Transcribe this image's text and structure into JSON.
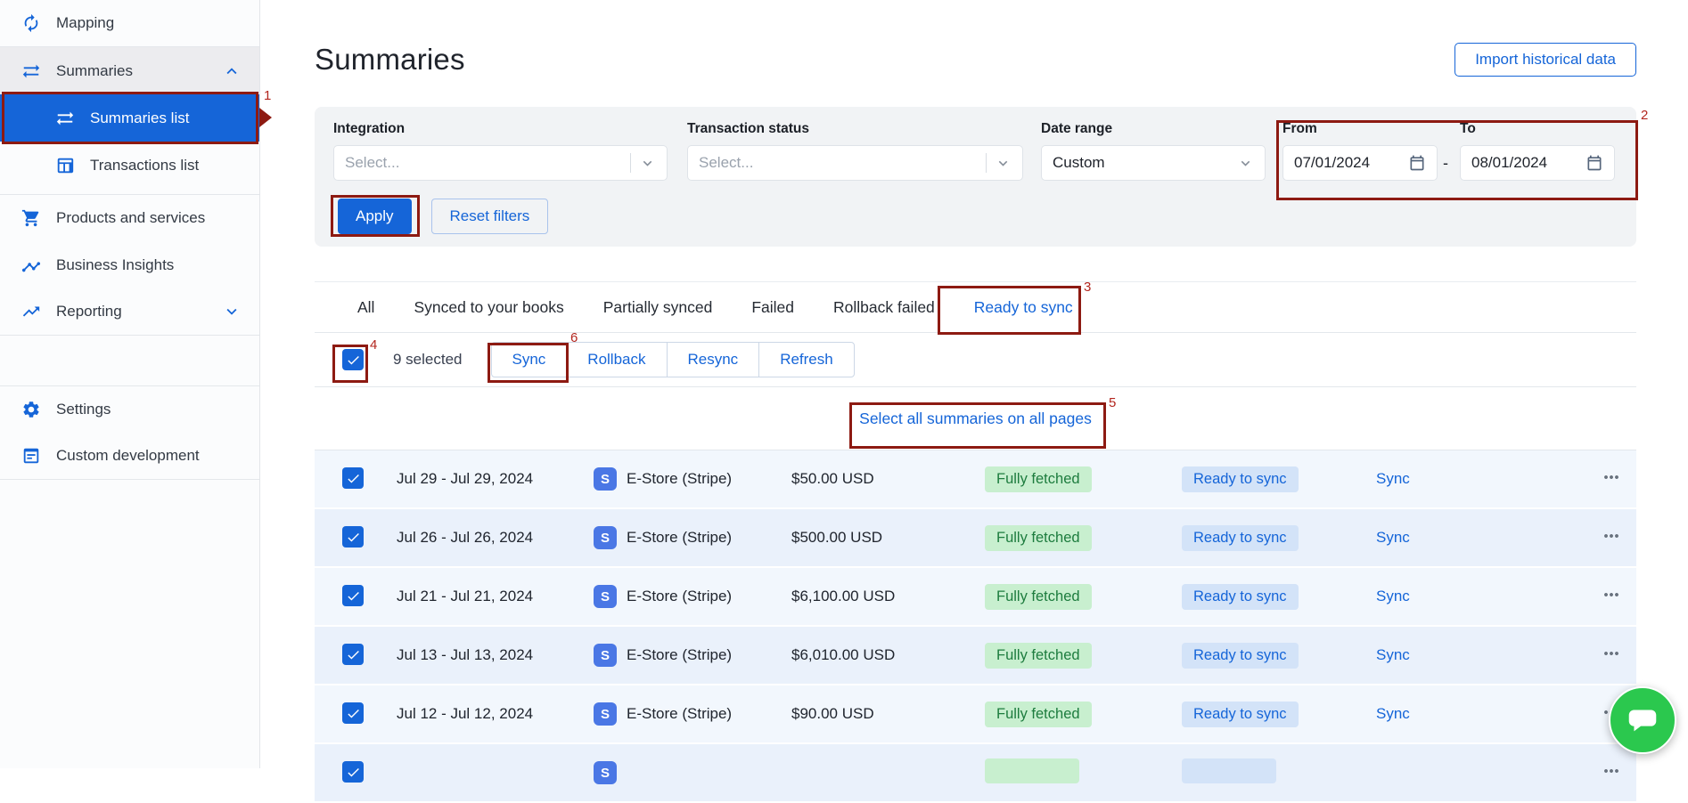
{
  "colors": {
    "accent": "#1565d8",
    "annotation": "#8d1a12",
    "annotation_number": "#b3261e",
    "badge_green_bg": "#c8efcf",
    "badge_green_text": "#1d7c3e",
    "badge_blue_bg": "#d3e3f8",
    "badge_blue_text": "#1565d8",
    "stripe_blue": "#4a77e5",
    "chat_green": "#2bc84e",
    "row_odd": "#f2f7fd",
    "row_even": "#eaf1fb"
  },
  "sidebar": {
    "items": [
      {
        "label": "Mapping",
        "icon": "autorenew-icon",
        "divider_after": true
      },
      {
        "label": "Summaries",
        "icon": "swap-arrows-icon",
        "chevron": "up",
        "variant": "parent-active"
      },
      {
        "label": "Summaries list",
        "icon": "swap-arrows-icon",
        "variant": "selected",
        "child": true
      },
      {
        "label": "Transactions list",
        "icon": "table-icon",
        "child": true
      },
      {
        "label": "Products and services",
        "icon": "cart-icon",
        "divider_before": true
      },
      {
        "label": "Business Insights",
        "icon": "insights-icon"
      },
      {
        "label": "Reporting",
        "icon": "trend-icon",
        "chevron": "down",
        "divider_after": true
      },
      {
        "label": "Settings",
        "icon": "gear-icon",
        "section_gap_before": true
      },
      {
        "label": "Custom development",
        "icon": "window-icon",
        "divider_after": true
      }
    ]
  },
  "header": {
    "title": "Summaries",
    "import_button_label": "Import historical data"
  },
  "filters": {
    "integration": {
      "label": "Integration",
      "placeholder": "Select..."
    },
    "transaction_status": {
      "label": "Transaction status",
      "placeholder": "Select..."
    },
    "date_range": {
      "label": "Date range",
      "value": "Custom"
    },
    "from": {
      "label": "From",
      "value": "07/01/2024"
    },
    "to": {
      "label": "To",
      "value": "08/01/2024"
    },
    "separator": "-",
    "apply_label": "Apply",
    "reset_label": "Reset filters"
  },
  "tabs": {
    "items": [
      "All",
      "Synced to your books",
      "Partially synced",
      "Failed",
      "Rollback failed",
      "Ready to sync"
    ],
    "active": "Ready to sync"
  },
  "selection_bar": {
    "selected_count": "9 selected",
    "actions": [
      "Sync",
      "Rollback",
      "Resync",
      "Refresh"
    ]
  },
  "select_all_link": "Select all summaries on all pages",
  "table": {
    "rows": [
      {
        "date_range": "Jul 29 - Jul 29, 2024",
        "integration_initial": "S",
        "integration": "E-Store (Stripe)",
        "amount": "$50.00 USD",
        "fetch_status": "Fully fetched",
        "sync_status": "Ready to sync",
        "action": "Sync"
      },
      {
        "date_range": "Jul 26 - Jul 26, 2024",
        "integration_initial": "S",
        "integration": "E-Store (Stripe)",
        "amount": "$500.00 USD",
        "fetch_status": "Fully fetched",
        "sync_status": "Ready to sync",
        "action": "Sync"
      },
      {
        "date_range": "Jul 21 - Jul 21, 2024",
        "integration_initial": "S",
        "integration": "E-Store (Stripe)",
        "amount": "$6,100.00 USD",
        "fetch_status": "Fully fetched",
        "sync_status": "Ready to sync",
        "action": "Sync"
      },
      {
        "date_range": "Jul 13 - Jul 13, 2024",
        "integration_initial": "S",
        "integration": "E-Store (Stripe)",
        "amount": "$6,010.00 USD",
        "fetch_status": "Fully fetched",
        "sync_status": "Ready to sync",
        "action": "Sync"
      },
      {
        "date_range": "Jul 12 - Jul 12, 2024",
        "integration_initial": "S",
        "integration": "E-Store (Stripe)",
        "amount": "$90.00 USD",
        "fetch_status": "Fully fetched",
        "sync_status": "Ready to sync",
        "action": "Sync"
      },
      {
        "date_range": "",
        "integration_initial": "S",
        "integration": "",
        "amount": "",
        "fetch_status": "",
        "sync_status": "",
        "action": "",
        "partial": true
      }
    ]
  },
  "annotations": [
    {
      "number": "1"
    },
    {
      "number": "2"
    },
    {
      "number": "3"
    },
    {
      "number": "4"
    },
    {
      "number": "5"
    },
    {
      "number": "6"
    }
  ]
}
